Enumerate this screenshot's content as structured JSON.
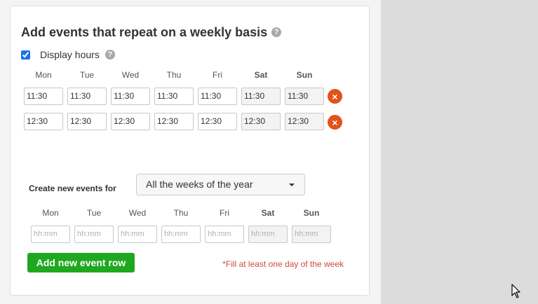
{
  "weekly": {
    "title": "Add events that repeat on a weekly basis",
    "help_icon": "?",
    "display_hours_label": "Display hours",
    "display_hours_checked": true,
    "days": [
      "Mon",
      "Tue",
      "Wed",
      "Thu",
      "Fri",
      "Sat",
      "Sun"
    ],
    "rows": [
      [
        "11:30",
        "11:30",
        "11:30",
        "11:30",
        "11:30",
        "11:30",
        "11:30"
      ],
      [
        "12:30",
        "12:30",
        "12:30",
        "12:30",
        "12:30",
        "12:30",
        "12:30"
      ]
    ],
    "remove_icon": "×"
  },
  "create": {
    "label": "Create new events for",
    "select_value": "All the weeks of the year",
    "days": [
      "Mon",
      "Tue",
      "Wed",
      "Thu",
      "Fri",
      "Sat",
      "Sun"
    ],
    "placeholder": "hh:mm",
    "add_button_label": "Add new event row",
    "warning": "*Fill at least one day of the week"
  },
  "colors": {
    "accent_green": "#1fa81f",
    "remove_red": "#e2531a",
    "warning_red": "#d04a3a"
  }
}
